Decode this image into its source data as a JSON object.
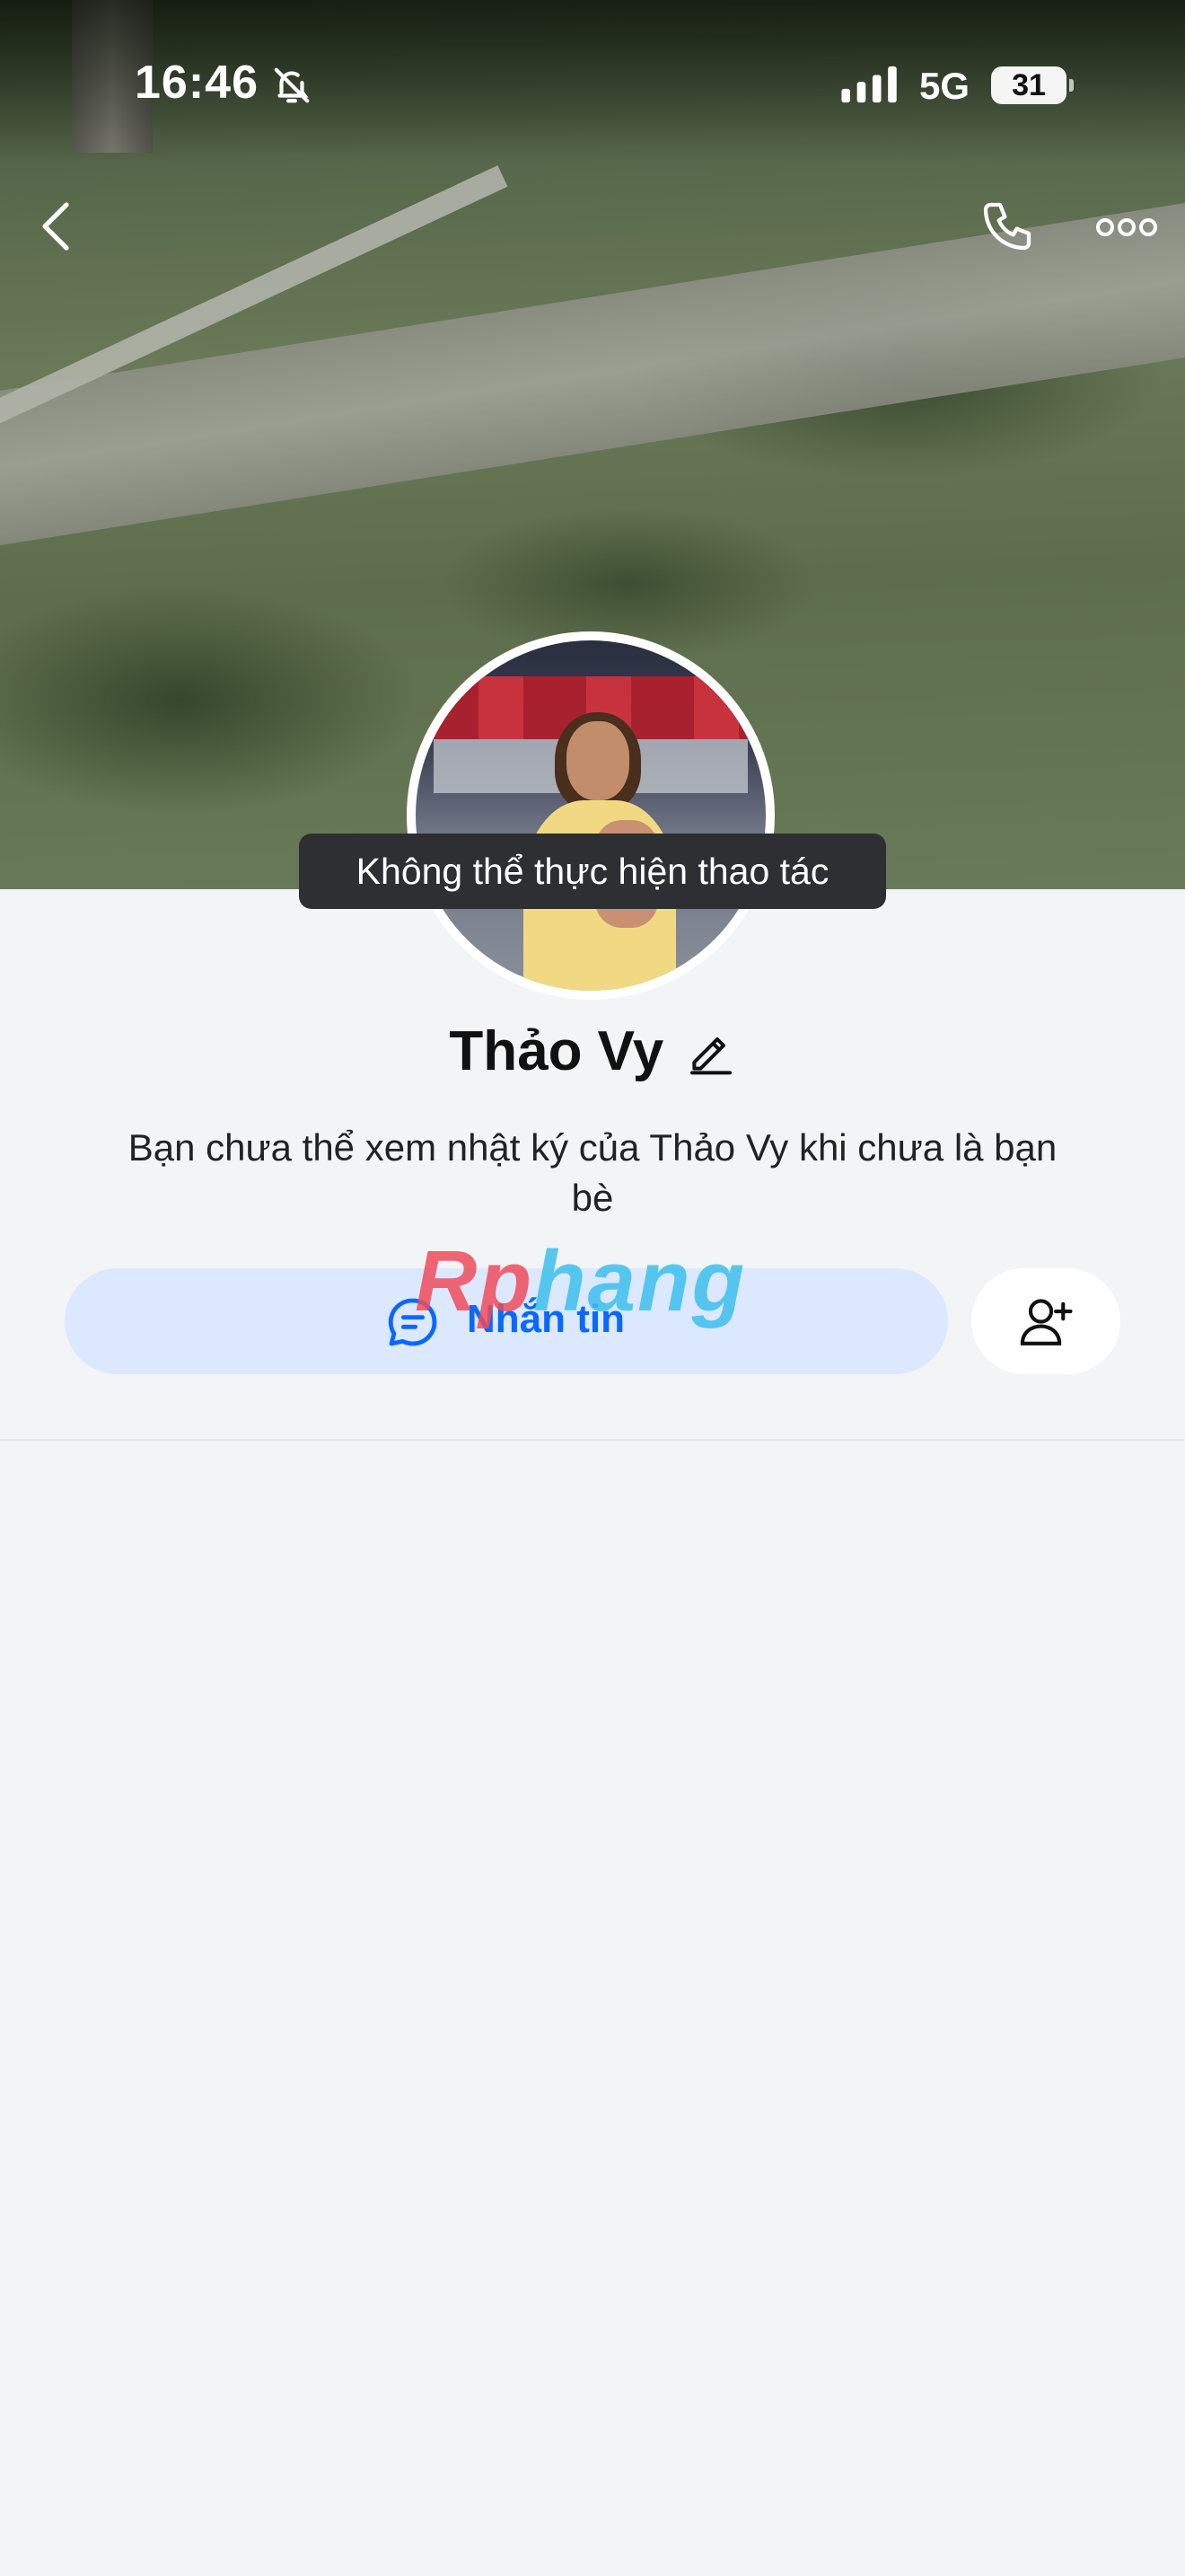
{
  "status_bar": {
    "time": "16:46",
    "network": "5G",
    "battery": "31"
  },
  "icons": {
    "back": "chevron-left-icon",
    "call": "phone-icon",
    "more": "more-horizontal-icon",
    "bell": "bell-slash-icon",
    "chat": "chat-bubble-icon",
    "add_friend": "add-friend-icon",
    "edit": "pencil-icon"
  },
  "toast": {
    "text": "Không thể thực hiện thao tác"
  },
  "profile": {
    "name": "Thảo Vy",
    "description": "Bạn chưa thể xem nhật ký của Thảo Vy khi chưa là bạn bè"
  },
  "actions": {
    "message_label": "Nhắn tin"
  },
  "watermark": {
    "part1": "Rp",
    "part2": "hang"
  },
  "colors": {
    "accent": "#0a68ff",
    "message_button_bg": "#dbe8fe",
    "page_bg": "#f3f4f6"
  }
}
